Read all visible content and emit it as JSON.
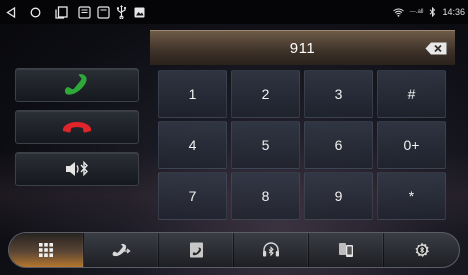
{
  "status_bar": {
    "time": "14:36",
    "signal_label": "—.all"
  },
  "dial": {
    "number": "911"
  },
  "keypad": {
    "keys": [
      "1",
      "2",
      "3",
      "#",
      "4",
      "5",
      "6",
      "0+",
      "7",
      "8",
      "9",
      "*"
    ]
  },
  "colors": {
    "call_green": "#2fa83a",
    "hangup_red": "#e0242c",
    "accent_orange": "#c9822f"
  },
  "dock": {
    "items": [
      "dialpad-icon",
      "recent-calls-icon",
      "contacts-icon",
      "bluetooth-music-icon",
      "phone-transfer-icon",
      "bluetooth-settings-icon"
    ],
    "active_index": 0
  }
}
